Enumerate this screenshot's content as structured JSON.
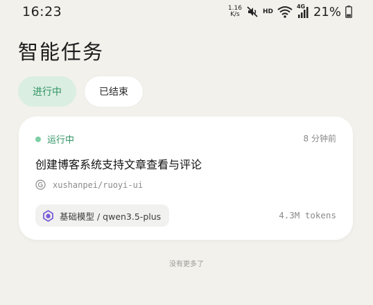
{
  "status_bar": {
    "time": "16:23",
    "net_speed_value": "1.16",
    "net_speed_unit": "K/s",
    "hd_label": "HD",
    "network_label": "4G",
    "battery_percent": "21%",
    "icons": [
      "mute-icon",
      "wifi-icon",
      "signal-icon",
      "battery-icon"
    ]
  },
  "page": {
    "title": "智能任务"
  },
  "tabs": [
    {
      "label": "进行中",
      "active": true
    },
    {
      "label": "已结束",
      "active": false
    }
  ],
  "task": {
    "status": "运行中",
    "time_ago": "8 分钟前",
    "title": "创建博客系统支持文章查看与评论",
    "repo": "xushanpei/ruoyi-ui",
    "model": "基础模型 / qwen3.5-plus",
    "tokens": "4.3M tokens"
  },
  "footer": {
    "no_more": "没有更多了"
  },
  "colors": {
    "background": "#f2f1ec",
    "accent_green": "#2f9363",
    "active_tab_bg": "#dbeee2",
    "status_dot": "#7ccfa4",
    "model_icon": "#7b5cd6"
  }
}
